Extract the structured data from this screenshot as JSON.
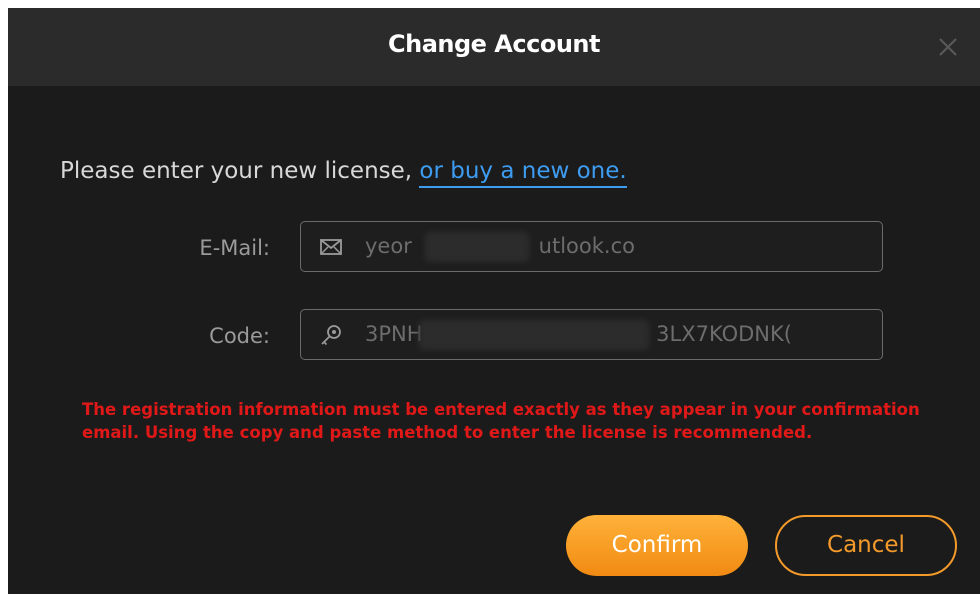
{
  "dialog": {
    "title": "Change Account",
    "close_icon": "close-icon"
  },
  "prompt": {
    "text": "Please enter your new license, ",
    "link": "or buy a new one."
  },
  "email": {
    "label": "E-Mail:",
    "icon": "envelope-icon",
    "value": "yeor                   utlook.co"
  },
  "code": {
    "label": "Code:",
    "icon": "key-icon",
    "value": "3PNH                                   3LX7KODNK("
  },
  "warning": {
    "text": "The registration information must be entered exactly as they appear in your confirmation email. Using the copy and paste method to enter the license is recommended."
  },
  "buttons": {
    "confirm": "Confirm",
    "cancel": "Cancel"
  },
  "colors": {
    "accent": "#f39a2a",
    "link": "#3d9cf0",
    "warning": "#e01818",
    "background": "#1b1b1b",
    "titlebar": "#2b2b2b"
  }
}
